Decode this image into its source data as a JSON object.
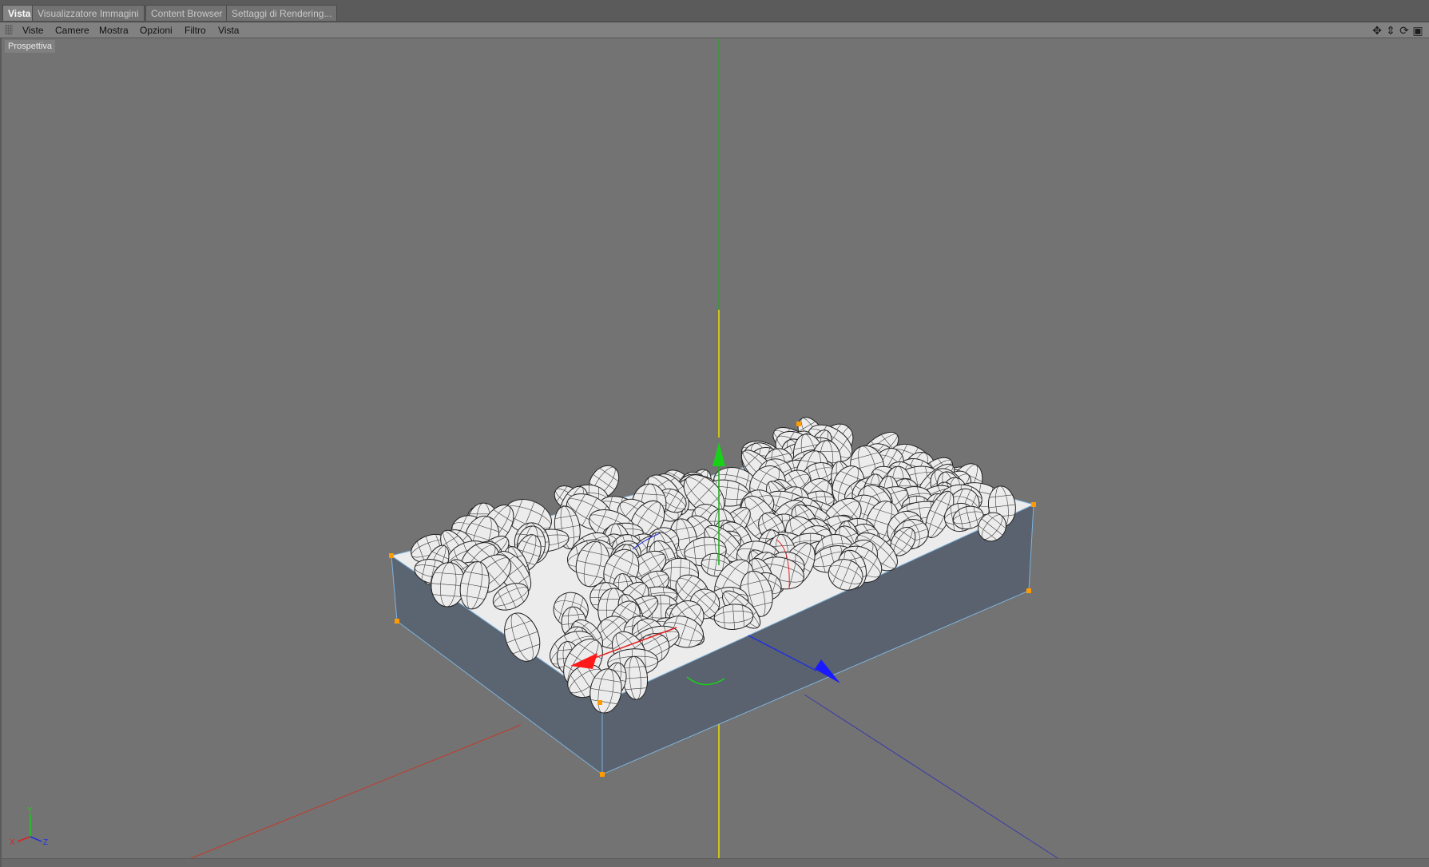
{
  "tabs": {
    "vista": "Vista",
    "visualizzatore": "Visualizzatore Immagini",
    "content_browser": "Content Browser",
    "settaggi": "Settaggi di Rendering..."
  },
  "menu": {
    "viste": "Viste",
    "camere": "Camere",
    "mostra": "Mostra",
    "opzioni": "Opzioni",
    "filtro": "Filtro",
    "vista": "Vista"
  },
  "viewport": {
    "camera_label": "Prospettiva"
  },
  "nav_icons": [
    "move-view-icon",
    "zoom-view-icon",
    "rotate-view-icon",
    "toggle-layout-icon"
  ],
  "axis_labels": {
    "x": "X",
    "y": "Y",
    "z": "Z"
  },
  "colors": {
    "x_axis": "#e02020",
    "y_axis": "#20c020",
    "z_axis": "#2030e0",
    "box_side": "#5b6571",
    "box_edge": "#7fb2dc",
    "handle": "#ff9a00",
    "stone_fill": "#ececec",
    "stone_wire": "#222222"
  }
}
